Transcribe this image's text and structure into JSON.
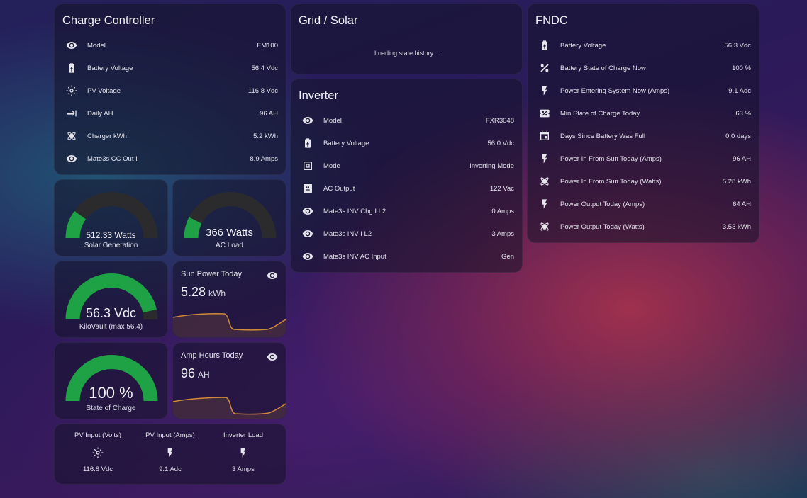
{
  "charge_controller": {
    "title": "Charge Controller",
    "rows": [
      {
        "icon": "eye-icon",
        "label": "Model",
        "value": "FM100"
      },
      {
        "icon": "battery-charging-icon",
        "label": "Battery Voltage",
        "value": "56.4 Vdc"
      },
      {
        "icon": "sun-icon",
        "label": "PV Voltage",
        "value": "116.8 Vdc"
      },
      {
        "icon": "arrow-collapse-right-icon",
        "label": "Daily AH",
        "value": "96 AH"
      },
      {
        "icon": "atom-icon",
        "label": "Charger kWh",
        "value": "5.2 kWh"
      },
      {
        "icon": "eye-icon",
        "label": "Mate3s CC Out I",
        "value": "8.9 Amps"
      }
    ]
  },
  "gauges": {
    "solar_generation": {
      "value": "512.33 Watts",
      "name": "Solar Generation",
      "fraction": 0.2
    },
    "ac_load": {
      "value": "366 Watts",
      "name": "AC Load",
      "fraction": 0.15
    },
    "kilovault": {
      "value": "56.3 Vdc",
      "name": "KiloVault (max 56.4)",
      "fraction": 0.93
    },
    "state_of_charge": {
      "value": "100 %",
      "name": "State of Charge",
      "fraction": 1.0
    }
  },
  "sun_power_today": {
    "name": "Sun Power Today",
    "value": "5.28",
    "unit": "kWh",
    "icon": "eye-icon"
  },
  "amp_hours_today": {
    "name": "Amp Hours Today",
    "value": "96",
    "unit": "AH",
    "icon": "eye-icon"
  },
  "glance": [
    {
      "name": "PV Input (Volts)",
      "icon": "sun-icon",
      "value": "116.8 Vdc"
    },
    {
      "name": "PV Input (Amps)",
      "icon": "flash-icon",
      "value": "9.1 Adc"
    },
    {
      "name": "Inverter Load",
      "icon": "flash-icon",
      "value": "3 Amps"
    }
  ],
  "grid_solar": {
    "title": "Grid / Solar",
    "loading": "Loading state history..."
  },
  "inverter": {
    "title": "Inverter",
    "rows": [
      {
        "icon": "eye-icon",
        "label": "Model",
        "value": "FXR3048"
      },
      {
        "icon": "battery-charging-icon",
        "label": "Battery Voltage",
        "value": "56.0 Vdc"
      },
      {
        "icon": "mode-box-icon",
        "label": "Mode",
        "value": "Inverting Mode"
      },
      {
        "icon": "power-socket-icon",
        "label": "AC Output",
        "value": "122 Vac"
      },
      {
        "icon": "eye-icon",
        "label": "Mate3s INV Chg I L2",
        "value": "0 Amps"
      },
      {
        "icon": "eye-icon",
        "label": "Mate3s INV I L2",
        "value": "3 Amps"
      },
      {
        "icon": "eye-icon",
        "label": "Mate3s INV AC Input",
        "value": "Gen"
      }
    ]
  },
  "fndc": {
    "title": "FNDC",
    "rows": [
      {
        "icon": "battery-charging-icon",
        "label": "Battery Voltage",
        "value": "56.3 Vdc"
      },
      {
        "icon": "percent-icon",
        "label": "Battery State of Charge Now",
        "value": "100 %"
      },
      {
        "icon": "flash-icon",
        "label": "Power Entering System Now (Amps)",
        "value": "9.1 Adc"
      },
      {
        "icon": "ticket-percent-icon",
        "label": "Min State of Charge Today",
        "value": "63 %"
      },
      {
        "icon": "calendar-icon",
        "label": "Days Since Battery Was Full",
        "value": "0.0 days"
      },
      {
        "icon": "flash-icon",
        "label": "Power In From Sun Today (Amps)",
        "value": "96 AH"
      },
      {
        "icon": "atom-icon",
        "label": "Power In From Sun Today (Watts)",
        "value": "5.28 kWh"
      },
      {
        "icon": "flash-icon",
        "label": "Power Output Today (Amps)",
        "value": "64 AH"
      },
      {
        "icon": "atom-icon",
        "label": "Power Output Today (Watts)",
        "value": "3.53 kWh"
      }
    ]
  },
  "colors": {
    "gauge_fill": "#1fa246",
    "gauge_track": "#2b2b2e",
    "graph_line": "#d08a3a"
  }
}
